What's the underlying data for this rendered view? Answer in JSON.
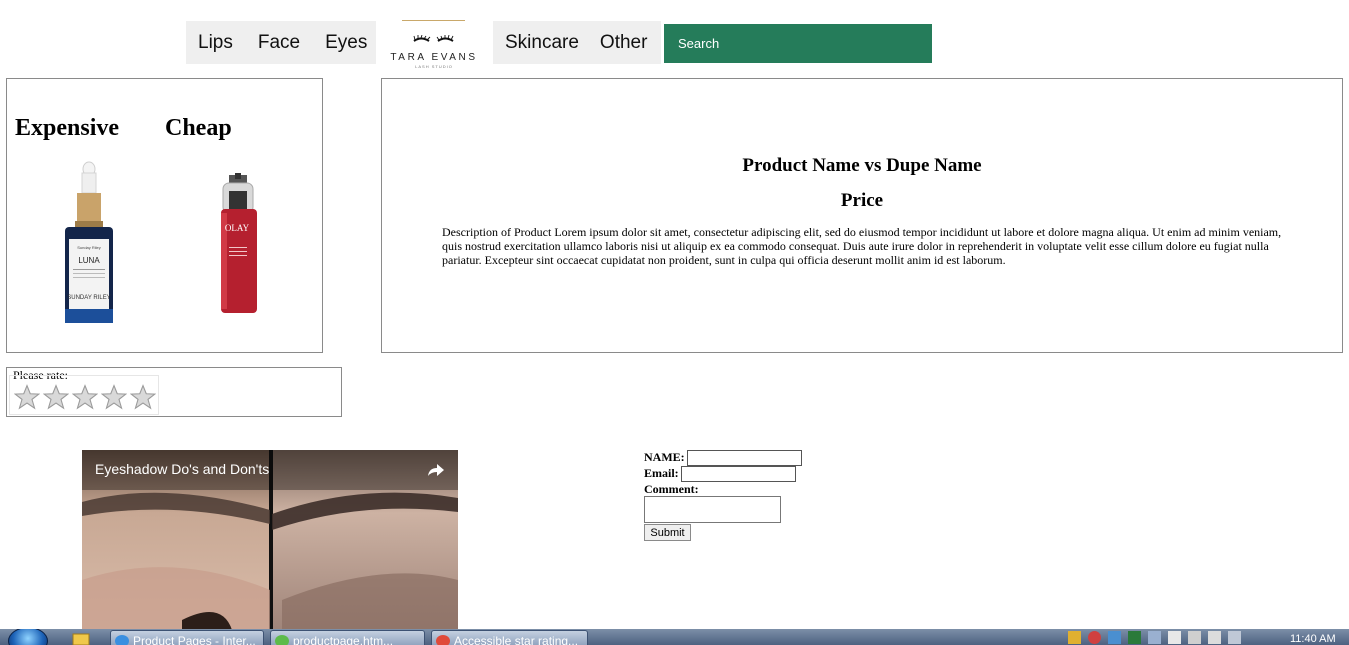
{
  "nav": {
    "left_items": [
      "Lips",
      "Face",
      "Eyes"
    ],
    "right_items": [
      "Skincare",
      "Other"
    ],
    "logo": {
      "brand": "TARA EVANS",
      "subtitle": "LASH STUDIO"
    },
    "search": {
      "placeholder": "Search",
      "value": ""
    }
  },
  "comparison": {
    "expensive_label": "Expensive",
    "cheap_label": "Cheap",
    "expensive_product": {
      "brand_top": "Sunday Riley",
      "name": "LUNA",
      "brand_bottom": "SUNDAY RILEY"
    },
    "cheap_product": {
      "brand": "OLAY"
    }
  },
  "product": {
    "title": "Product Name vs Dupe Name",
    "price_label": "Price",
    "description": "Description of Product Lorem ipsum dolor sit amet, consectetur adipiscing elit, sed do eiusmod tempor incididunt ut labore et dolore magna aliqua. Ut enim ad minim veniam, quis nostrud exercitation ullamco laboris nisi ut aliquip ex ea commodo consequat. Duis aute irure dolor in reprehenderit in voluptate velit esse cillum dolore eu fugiat nulla pariatur. Excepteur sint occaecat cupidatat non proident, sunt in culpa qui officia deserunt mollit anim id est laborum."
  },
  "rating": {
    "label": "Please rate:",
    "max_stars": 5,
    "selected": 0
  },
  "video": {
    "title": "Eyeshadow Do's and Don'ts"
  },
  "form": {
    "name_label": "NAME:",
    "email_label": "Email:",
    "comment_label": "Comment:",
    "name_value": "",
    "email_value": "",
    "comment_value": "",
    "submit_label": "Submit"
  },
  "taskbar": {
    "buttons": [
      "Product Pages - Inter...",
      "productpage.htm...",
      "Accessible star rating..."
    ],
    "clock": "11:40 AM"
  },
  "colors": {
    "search_bg": "#257c5a",
    "nav_bg": "#efefef"
  }
}
